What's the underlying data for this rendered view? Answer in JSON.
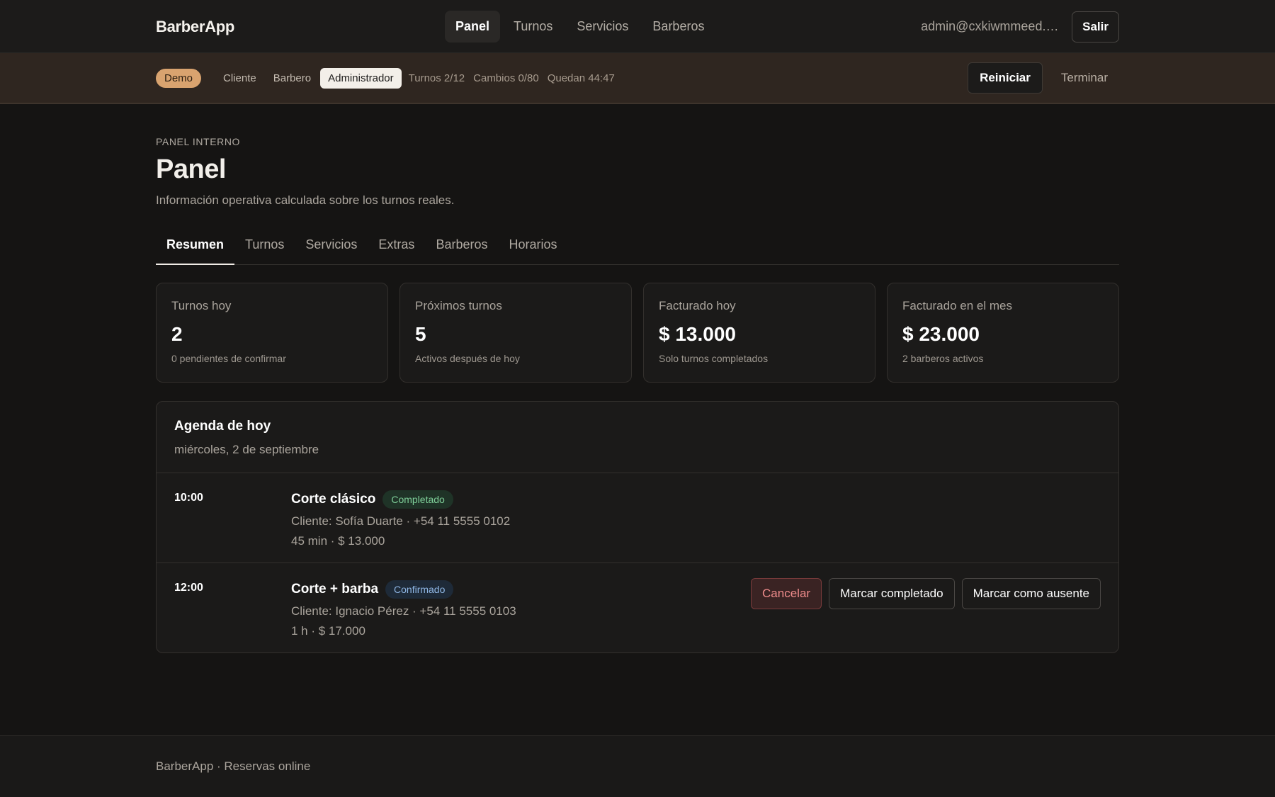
{
  "header": {
    "brand": "BarberApp",
    "nav": [
      "Panel",
      "Turnos",
      "Servicios",
      "Barberos"
    ],
    "user_email": "admin@cxkiwmmeed.d...",
    "logout_label": "Salir"
  },
  "demo": {
    "badge": "Demo",
    "roles": [
      "Cliente",
      "Barbero",
      "Administrador"
    ],
    "active_role": "Administrador",
    "turnos": "Turnos 2/12",
    "cambios": "Cambios 0/80",
    "quedan": "Quedan 44:47",
    "reset_label": "Reiniciar",
    "end_label": "Terminar"
  },
  "page": {
    "eyebrow": "PANEL INTERNO",
    "title": "Panel",
    "subtitle": "Información operativa calculada sobre los turnos reales."
  },
  "tabs": [
    "Resumen",
    "Turnos",
    "Servicios",
    "Extras",
    "Barberos",
    "Horarios"
  ],
  "stats": [
    {
      "label": "Turnos hoy",
      "value": "2",
      "note": "0 pendientes de confirmar"
    },
    {
      "label": "Próximos turnos",
      "value": "5",
      "note": "Activos después de hoy"
    },
    {
      "label": "Facturado hoy",
      "value": "$ 13.000",
      "note": "Solo turnos completados"
    },
    {
      "label": "Facturado en el mes",
      "value": "$ 23.000",
      "note": "2 barberos activos"
    }
  ],
  "agenda": {
    "title": "Agenda de hoy",
    "date": "miércoles, 2 de septiembre",
    "items": [
      {
        "time": "10:00",
        "service": "Corte clásico",
        "status": "Completado",
        "client": "Cliente: Sofía Duarte · +54 11 5555 0102",
        "details": "45 min · $ 13.000"
      },
      {
        "time": "12:00",
        "service": "Corte + barba",
        "status": "Confirmado",
        "client": "Cliente: Ignacio Pérez · +54 11 5555 0103",
        "details": "1 h · $ 17.000",
        "actions": {
          "cancel": "Cancelar",
          "complete": "Marcar completado",
          "absent": "Marcar como ausente"
        }
      }
    ]
  },
  "footer": {
    "text": "BarberApp · Reservas online"
  }
}
